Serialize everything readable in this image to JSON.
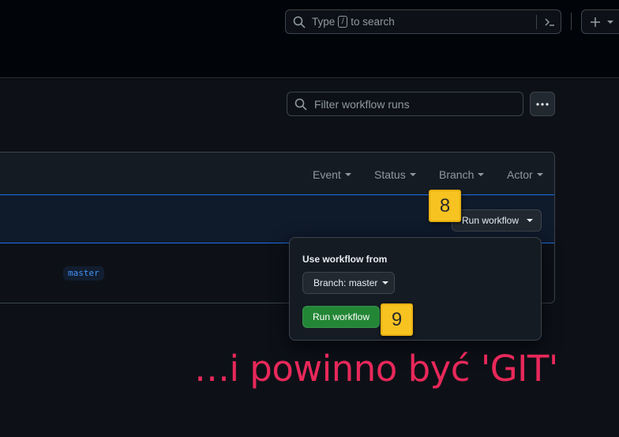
{
  "header": {
    "search_placeholder_before": "Type",
    "search_shortcut_key": "/",
    "search_placeholder_after": "to search"
  },
  "actions": {
    "filter_placeholder": "Filter workflow runs"
  },
  "table": {
    "filters": [
      "Event",
      "Status",
      "Branch",
      "Actor"
    ],
    "row_branch_tag": "master"
  },
  "run_workflow": {
    "button_label": "Run workflow",
    "popover_title": "Use workflow from",
    "branch_select_label": "Branch: master",
    "submit_label": "Run workflow"
  },
  "annotations": {
    "step_8": "8",
    "step_9": "9",
    "caption": "…i powinno być 'GIT'",
    "badge_color": "#f7c321",
    "caption_color": "#e8285a"
  }
}
